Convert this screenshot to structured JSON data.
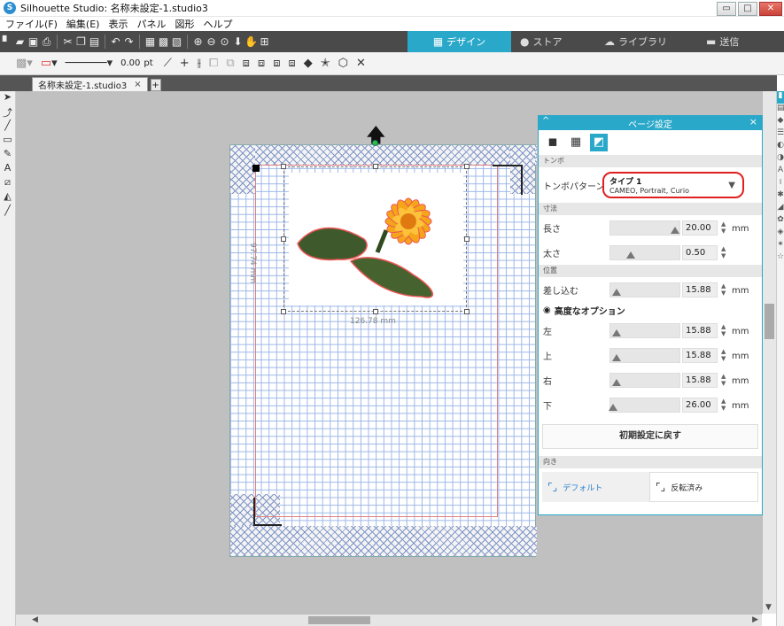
{
  "window": {
    "title": "Silhouette Studio: 名称未設定-1.studio3",
    "minimize": "▭",
    "maximize": "□",
    "close": "✕"
  },
  "menu": [
    "ファイル(F)",
    "編集(E)",
    "表示",
    "パネル",
    "図形",
    "ヘルプ"
  ],
  "main_tabs": [
    {
      "label": "デザイン",
      "icon": "grid-icon",
      "active": true
    },
    {
      "label": "ストア",
      "icon": "silhouette-logo-icon",
      "active": false
    },
    {
      "label": "ライブラリ",
      "icon": "cloud-icon",
      "active": false
    },
    {
      "label": "送信",
      "icon": "cutter-icon",
      "active": false
    }
  ],
  "toolbar2": {
    "line_width": "0.00",
    "line_unit": "pt"
  },
  "document_tab": {
    "name": "名称未設定-1.studio3",
    "close": "×",
    "add": "+"
  },
  "canvas": {
    "width_dimension": "126.78 mm",
    "height_dimension": "97.74 mm"
  },
  "panel": {
    "title": "ページ設定",
    "close": "×",
    "collapse": "^",
    "sections": {
      "tombo": "トンボ",
      "dimensions": "寸法",
      "position": "位置",
      "orientation": "向き"
    },
    "tombo_pattern_label": "トンボパターン",
    "tombo_type": "タイプ 1",
    "tombo_devices": "CAMEO, Portrait, Curio",
    "length_label": "長さ",
    "length_value": "20.00",
    "thickness_label": "太さ",
    "thickness_value": "0.50",
    "inset_label": "差し込む",
    "inset_value": "15.88",
    "advanced_label": "高度なオプション",
    "left_label": "左",
    "left_value": "15.88",
    "top_label": "上",
    "top_value": "15.88",
    "right_label": "右",
    "right_value": "15.88",
    "bottom_label": "下",
    "bottom_value": "26.00",
    "unit": "mm",
    "reset_label": "初期設定に戻す",
    "orientation_default": "デフォルト",
    "orientation_flipped": "反転済み"
  },
  "colors": {
    "accent": "#2aa8c9",
    "highlight_ring": "#e02020",
    "toolbar_dark": "#4a4a4a"
  }
}
